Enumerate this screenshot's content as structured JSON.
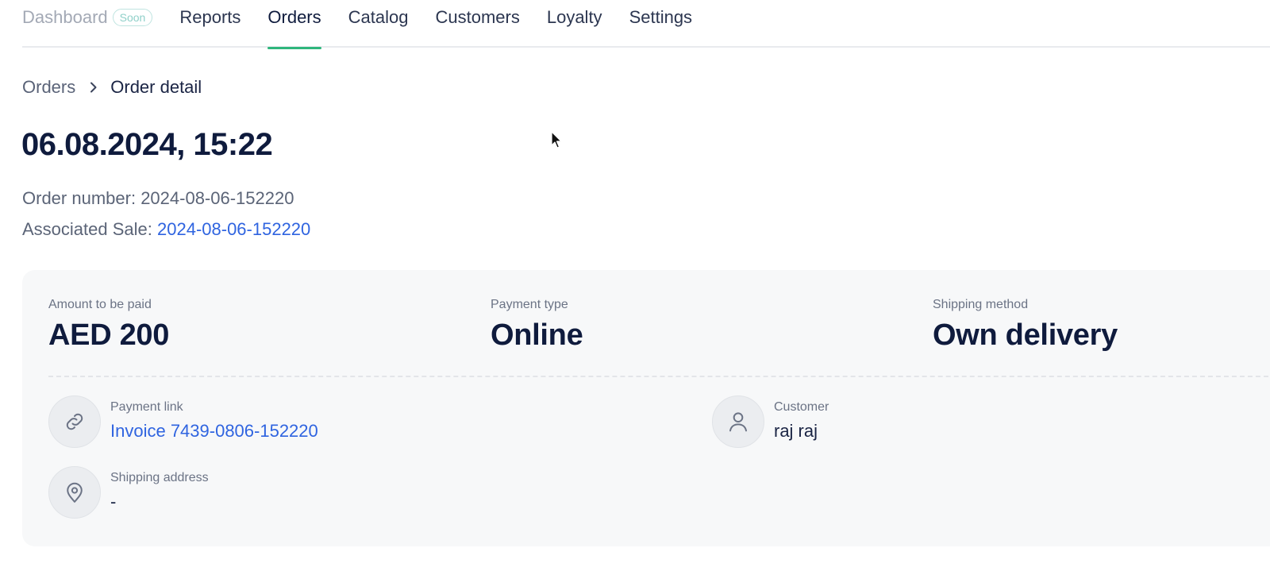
{
  "nav": {
    "items": [
      {
        "label": "Dashboard",
        "badge": "Soon",
        "state": "disabled"
      },
      {
        "label": "Reports",
        "state": "normal"
      },
      {
        "label": "Orders",
        "state": "active"
      },
      {
        "label": "Catalog",
        "state": "normal"
      },
      {
        "label": "Customers",
        "state": "normal"
      },
      {
        "label": "Loyalty",
        "state": "normal"
      },
      {
        "label": "Settings",
        "state": "normal"
      }
    ],
    "active_color": "#2fb67c"
  },
  "breadcrumb": {
    "parent": "Orders",
    "current": "Order detail",
    "separator_icon": "chevron-right-icon"
  },
  "order": {
    "title": "06.08.2024, 15:22",
    "order_number_label": "Order number:",
    "order_number": "2024-08-06-152220",
    "associated_sale_label": "Associated Sale:",
    "associated_sale": "2024-08-06-152220"
  },
  "summary": {
    "amount": {
      "label": "Amount to be paid",
      "value": "AED 200"
    },
    "payment_type": {
      "label": "Payment type",
      "value": "Online"
    },
    "shipping_method": {
      "label": "Shipping method",
      "value": "Own delivery"
    }
  },
  "details": {
    "payment_link": {
      "label": "Payment link",
      "value": "Invoice 7439-0806-152220",
      "icon": "link-icon"
    },
    "customer": {
      "label": "Customer",
      "value": "raj raj",
      "icon": "user-icon"
    },
    "shipping_address": {
      "label": "Shipping address",
      "value": "-",
      "icon": "location-pin-icon"
    }
  },
  "colors": {
    "link": "#2f64e0",
    "title": "#0f1b3d",
    "card_bg": "#f7f8f9"
  }
}
